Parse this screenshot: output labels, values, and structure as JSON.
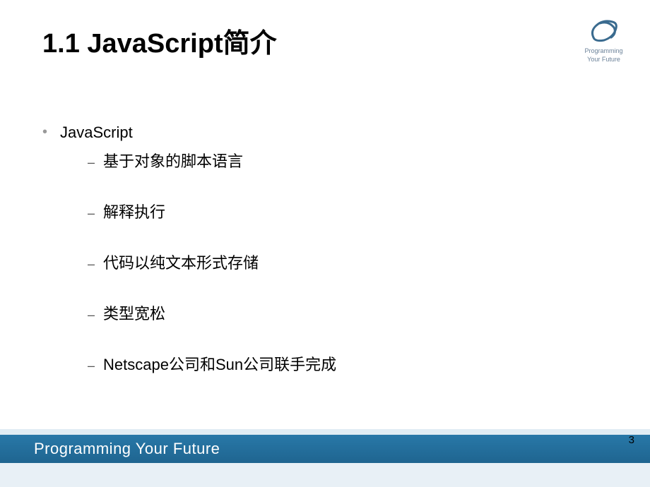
{
  "slide": {
    "title": "1.1 JavaScript简介",
    "logo": {
      "line1": "Programming",
      "line2": "Your Future"
    },
    "topBullet": "JavaScript",
    "subBullets": [
      "基于对象的脚本语言",
      "解释执行",
      "代码以纯文本形式存储",
      "类型宽松",
      "Netscape公司和Sun公司联手完成"
    ],
    "footer": {
      "tagline": "Programming Your Future",
      "pageNumber": "3"
    }
  }
}
